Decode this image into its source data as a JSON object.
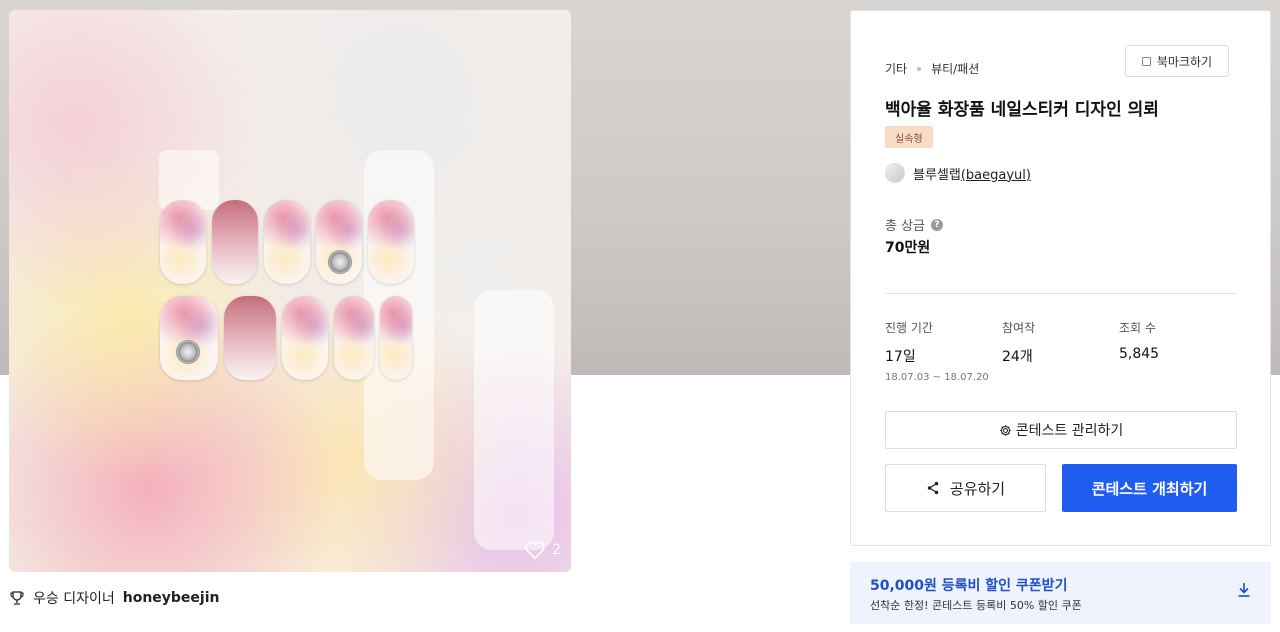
{
  "image": {
    "likes_count": "2",
    "icons": {
      "likes": "heart-icon"
    }
  },
  "winner": {
    "icon": "trophy-icon",
    "label": "우승 디자이너",
    "name": "honeybeejin"
  },
  "contest": {
    "category": [
      "기타",
      "뷰티/패션"
    ],
    "bookmark_label": "북마크하기",
    "title": "백아율 화장품 네일스티커 디자인 의뢰",
    "type_badge": "실속형",
    "host_name": "블루셀랩",
    "host_user": "(baegayul)",
    "prize_label": "총 상금",
    "prize_value": "70만원",
    "stats": {
      "period_label": "진행 기간",
      "period_value": "17일",
      "period_dates": "18.07.03 ~ 18.07.20",
      "entries_label": "참여작",
      "entries_value": "24개",
      "views_label": "조회 수",
      "views_value": "5,845"
    },
    "manage_label": "콘테스트 관리하기",
    "share_label": "공유하기",
    "host_button_label": "콘테스트 개최하기",
    "colors": {
      "primary": "#1f5cf0",
      "badge_bg": "#f7dcc8"
    }
  },
  "coupon": {
    "title": "50,000원 등록비 할인 쿠폰받기",
    "subtitle": "선착순 한정! 콘테스트 등록비 50% 할인 쿠폰",
    "icon": "download-icon"
  }
}
